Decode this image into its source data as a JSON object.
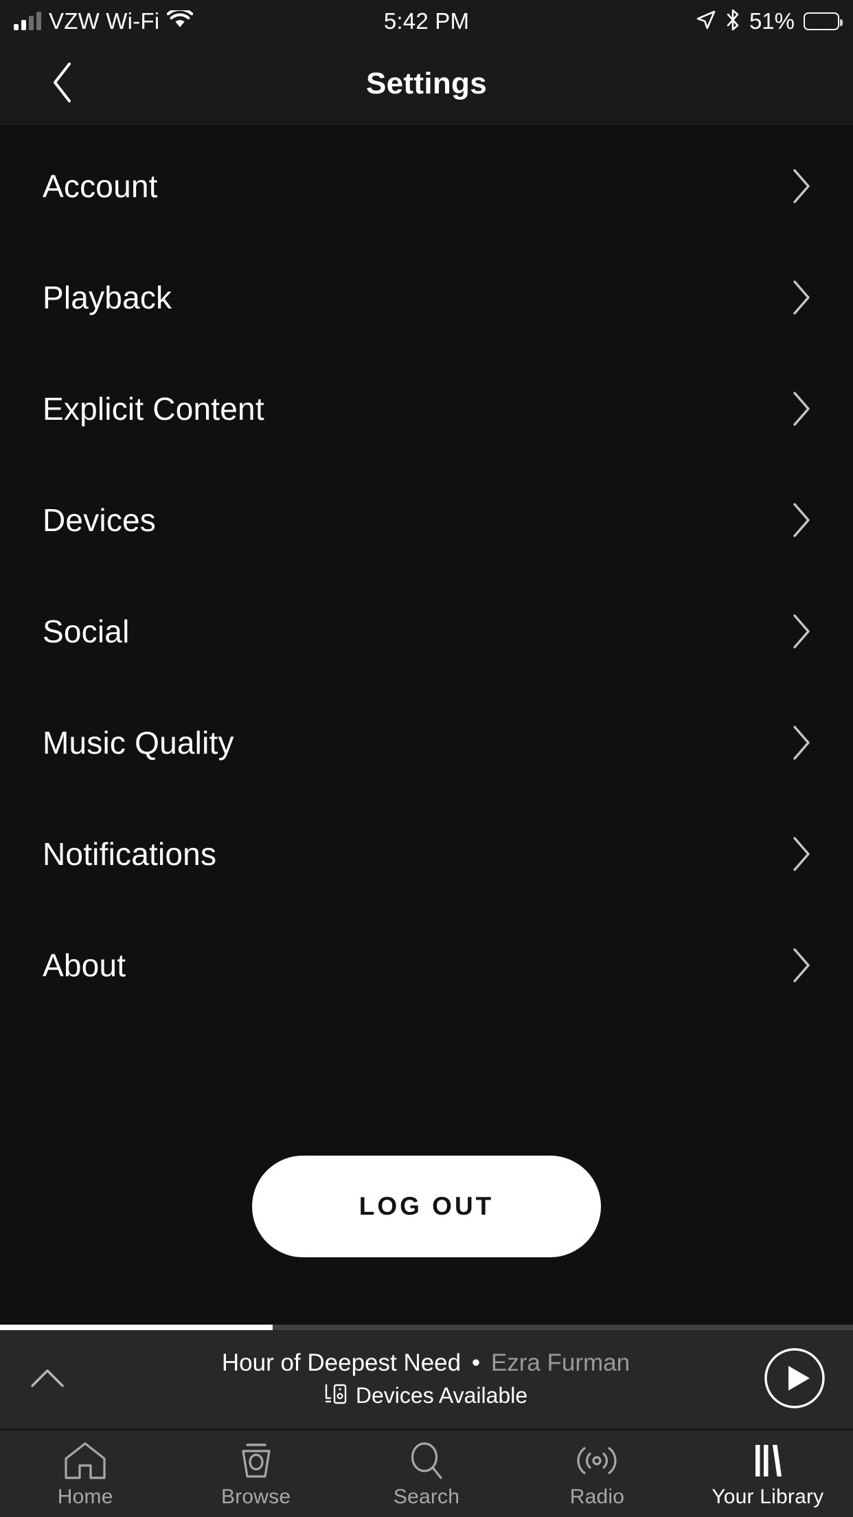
{
  "status_bar": {
    "signal_bars_filled": 2,
    "signal_bars_total": 4,
    "carrier": "VZW Wi-Fi",
    "wifi_icon": "wifi-icon",
    "time": "5:42 PM",
    "location_icon": "location-arrow-icon",
    "bluetooth_icon": "bluetooth-icon",
    "battery_percent": "51%",
    "battery_level": 51
  },
  "header": {
    "back_icon": "chevron-left-icon",
    "title": "Settings"
  },
  "settings_list": {
    "chevron_icon": "chevron-right-icon",
    "items": [
      {
        "label": "Account"
      },
      {
        "label": "Playback"
      },
      {
        "label": "Explicit Content"
      },
      {
        "label": "Devices"
      },
      {
        "label": "Social"
      },
      {
        "label": "Music Quality"
      },
      {
        "label": "Notifications"
      },
      {
        "label": "About"
      }
    ]
  },
  "logout": {
    "label": "LOG OUT"
  },
  "now_playing": {
    "expand_icon": "chevron-up-icon",
    "progress_percent": 32,
    "title": "Hour of Deepest Need",
    "separator": "•",
    "artist": "Ezra Furman",
    "devices_icon": "devices-icon",
    "devices_label": "Devices Available",
    "play_icon": "play-icon"
  },
  "tab_bar": {
    "tabs": [
      {
        "label": "Home",
        "icon": "home-icon",
        "active": false
      },
      {
        "label": "Browse",
        "icon": "browse-icon",
        "active": false
      },
      {
        "label": "Search",
        "icon": "search-icon",
        "active": false
      },
      {
        "label": "Radio",
        "icon": "radio-icon",
        "active": false
      },
      {
        "label": "Your Library",
        "icon": "library-icon",
        "active": true
      }
    ]
  },
  "colors": {
    "status_bar_bg": "#1a1a1a",
    "header_bg": "#1a1a1a",
    "list_bg": "#101010",
    "now_playing_bg": "#282828",
    "tab_bar_bg": "#282828",
    "text_primary": "#ffffff",
    "text_muted": "#9a9a9a",
    "tab_inactive": "#a8a8a8",
    "accent": "#ffffff"
  }
}
